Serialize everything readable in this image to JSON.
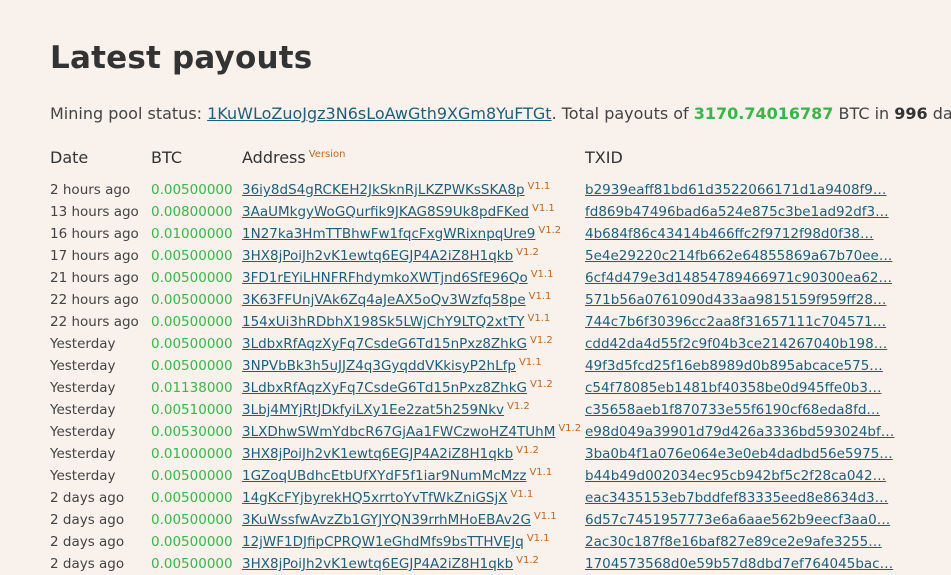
{
  "title": "Latest payouts",
  "status": {
    "prefix": "Mining pool status: ",
    "address": "1KuWLoZuoJgz3N6sLoAwGth9XGm8YuFTGt",
    "mid": ". Total payouts of ",
    "total": "3170.74016787",
    "btc_in": " BTC in ",
    "days": "996",
    "suffix": " days."
  },
  "table": {
    "headers": {
      "date": "Date",
      "btc": "BTC",
      "address": "Address",
      "version": "Version",
      "txid": "TXID"
    },
    "rows": [
      {
        "date": "2 hours ago",
        "btc": "0.00500000",
        "address": "36iy8dS4gRCKEH2JkSknRjLKZPWKsSKA8p",
        "version": "V1.1",
        "txid": "b2939eaff81bd61d3522066171d1a9408f9…"
      },
      {
        "date": "13 hours ago",
        "btc": "0.00800000",
        "address": "3AaUMkgyWoGQurfik9JKAG8S9Uk8pdFKed",
        "version": "V1.1",
        "txid": "fd869b47496bad6a524e875c3be1ad92df3…"
      },
      {
        "date": "16 hours ago",
        "btc": "0.01000000",
        "address": "1N27ka3HmTTBhwFw1fqcFxgWRixnpqUre9",
        "version": "V1.2",
        "txid": "4b684f86c43414b466ffc2f9712f98d0f38…"
      },
      {
        "date": "17 hours ago",
        "btc": "0.00500000",
        "address": "3HX8jPoiJh2vK1ewtq6EGJP4A2iZ8H1qkb",
        "version": "V1.2",
        "txid": "5e4e29220c214fb662e64855869a67b70ee…"
      },
      {
        "date": "21 hours ago",
        "btc": "0.00500000",
        "address": "3FD1rEYiLHNFRFhdymkoXWTjnd6SfE96Qo",
        "version": "V1.1",
        "txid": "6cf4d479e3d14854789466971c90300ea62…"
      },
      {
        "date": "22 hours ago",
        "btc": "0.00500000",
        "address": "3K63FFUnjVAk6Zq4aJeAX5oQv3Wzfq58pe",
        "version": "V1.1",
        "txid": "571b56a0761090d433aa9815159f959ff28…"
      },
      {
        "date": "22 hours ago",
        "btc": "0.00500000",
        "address": "154xUi3hRDbhX198Sk5LWjChY9LTQ2xtTY",
        "version": "V1.1",
        "txid": "744c7b6f30396cc2aa8f31657111c704571…"
      },
      {
        "date": "Yesterday",
        "btc": "0.00500000",
        "address": "3LdbxRfAqzXyFq7CsdeG6Td15nPxz8ZhkG",
        "version": "V1.2",
        "txid": "cdd42da4d55f2c9f04b3ce214267040b198…"
      },
      {
        "date": "Yesterday",
        "btc": "0.00500000",
        "address": "3NPVbBk3h5uJJZ4q3GyqddVKkisyP2hLfp",
        "version": "V1.1",
        "txid": "49f3d5fcd25f16eb8989d0b895abcace575…"
      },
      {
        "date": "Yesterday",
        "btc": "0.01138000",
        "address": "3LdbxRfAqzXyFq7CsdeG6Td15nPxz8ZhkG",
        "version": "V1.2",
        "txid": "c54f78085eb1481bf40358be0d945ffe0b3…"
      },
      {
        "date": "Yesterday",
        "btc": "0.00510000",
        "address": "3Lbj4MYjRtJDkfyiLXy1Ee2zat5h259Nkv",
        "version": "V1.2",
        "txid": "c35658aeb1f870733e55f6190cf68eda8fd…"
      },
      {
        "date": "Yesterday",
        "btc": "0.00530000",
        "address": "3LXDhwSWmYdbcR67GjAa1FWCzwoHZ4TUhM",
        "version": "V1.2",
        "txid": "e98d049a39901d79d426a3336bd593024bf…"
      },
      {
        "date": "Yesterday",
        "btc": "0.01000000",
        "address": "3HX8jPoiJh2vK1ewtq6EGJP4A2iZ8H1qkb",
        "version": "V1.2",
        "txid": "3ba0b4f1a076e064e3e0eb4dadbd56e5975…"
      },
      {
        "date": "Yesterday",
        "btc": "0.00500000",
        "address": "1GZoqUBdhcEtbUfXYdF5f1iar9NumMcMzz",
        "version": "V1.1",
        "txid": "b44b49d002034ec95cb942bf5c2f28ca042…"
      },
      {
        "date": "2 days ago",
        "btc": "0.00500000",
        "address": "14gKcFYjbyrekHQ5xrrtoYvTfWkZniGSjX",
        "version": "V1.1",
        "txid": "eac3435153eb7bddfef83335eed8e8634d3…"
      },
      {
        "date": "2 days ago",
        "btc": "0.00500000",
        "address": "3KuWssfwAvzZb1GYJYQN39rrhMHoEBAv2G",
        "version": "V1.1",
        "txid": "6d57c7451957773e6a6aae562b9eecf3aa0…"
      },
      {
        "date": "2 days ago",
        "btc": "0.00500000",
        "address": "12jWF1DJfipCPRQW1eGhdMfs9bsTTHVEJq",
        "version": "V1.1",
        "txid": "2ac30c187f8e16baf827e89ce2e9afe3255…"
      },
      {
        "date": "2 days ago",
        "btc": "0.00500000",
        "address": "3HX8jPoiJh2vK1ewtq6EGJP4A2iZ8H1qkb",
        "version": "V1.2",
        "txid": "1704573568d0e59b57d8dbd7ef764045bac…"
      }
    ]
  }
}
